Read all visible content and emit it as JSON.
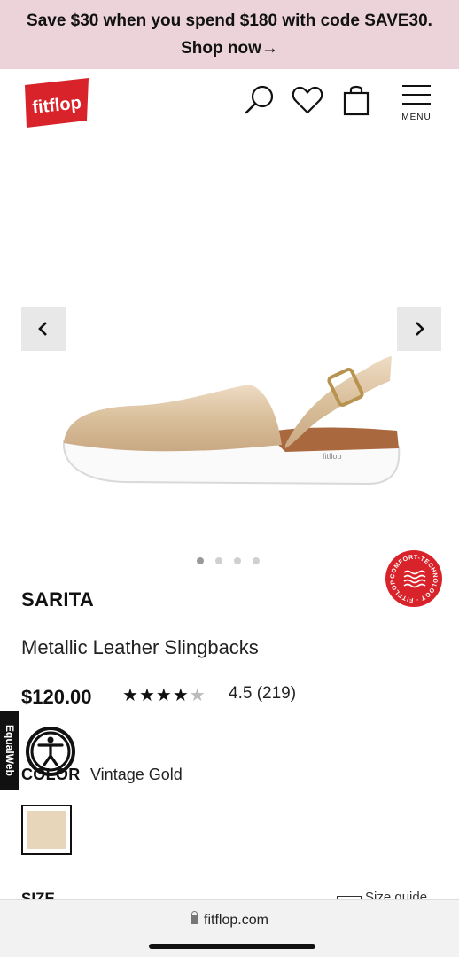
{
  "promo": {
    "line1": "Save $30 when you spend $180 with code SAVE30.",
    "line2": "Shop now→"
  },
  "header": {
    "logo_text": "fitflop",
    "menu_label": "MENU",
    "icons": [
      "search-icon",
      "heart-icon",
      "bag-icon",
      "hamburger-icon"
    ],
    "logo_color": "#d8232a"
  },
  "gallery": {
    "prev_icon": "chevron-left-icon",
    "next_icon": "chevron-right-icon",
    "dots": 4,
    "active_dot": 1,
    "badge_text": "COMFORT-TECHNOLOGY · FITFLOP ·",
    "badge_color": "#d8232a"
  },
  "product": {
    "name": "SARITA",
    "description": "Metallic Leather Slingbacks",
    "price": "$120.00",
    "stars": "★★★★★",
    "rating_text": "4.5 (219)",
    "rating_value": 4.5
  },
  "equalweb": {
    "label": "EqualWeb"
  },
  "color": {
    "label": "COLOR",
    "value": "Vintage Gold",
    "swatch_color": "#e7d6b9"
  },
  "size": {
    "label": "SIZE",
    "guide_label": "Size guide"
  },
  "browser": {
    "url": "fitflop.com"
  }
}
